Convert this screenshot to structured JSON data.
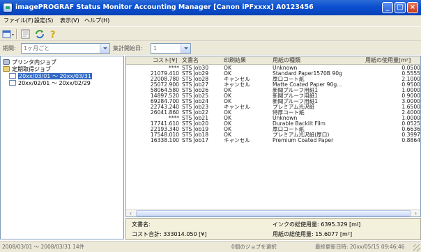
{
  "window": {
    "title": "imagePROGRAF Status Monitor Accounting Manager [Canon iPFxxxx] A0123456"
  },
  "menu": [
    "ファイル(F)",
    "設定(S)",
    "表示(V)",
    "ヘルプ(H)"
  ],
  "toolbar": {
    "icons": [
      "window-list-icon",
      "properties-icon",
      "refresh-icon",
      "help-icon"
    ]
  },
  "filter": {
    "period_label": "期間:",
    "period_value": "1ヶ月ごと",
    "start_label": "集計開始日:",
    "start_value": "1"
  },
  "tree": {
    "printer_jobs": "プリンタ内ジョブ",
    "saved_jobs": "定期取得ジョブ",
    "periods": [
      "20xx/03/01 〜 20xx/03/31",
      "20xx/02/01 〜 20xx/02/29"
    ],
    "selected_index": 0
  },
  "table": {
    "columns": [
      "コスト[¥]",
      "文書名",
      "印刷結果",
      "用紙の種類",
      "用紙の使用量[m²]"
    ],
    "rows": [
      {
        "cost": "****",
        "doc": "STS Job30",
        "result": "OK",
        "paper": "Unknown",
        "usage": "0.0500"
      },
      {
        "cost": "21079.410",
        "doc": "STS Job29",
        "result": "OK",
        "paper": "Standard Paper1570B 90g",
        "usage": "0.5555"
      },
      {
        "cost": "22008.780",
        "doc": "STS Job28",
        "result": "キャンセル",
        "paper": "厚口コート紙",
        "usage": "2.1000"
      },
      {
        "cost": "25072.900",
        "doc": "STS Job27",
        "result": "キャンセル",
        "paper": "Matte Coated Paper 90g...",
        "usage": "0.9500"
      },
      {
        "cost": "58064.580",
        "doc": "STS Job26",
        "result": "OK",
        "paper": "新聞プルーフ用紙1",
        "usage": "1.0000"
      },
      {
        "cost": "14897.520",
        "doc": "STS Job25",
        "result": "OK",
        "paper": "新聞プルーフ用紙1",
        "usage": "0.9000"
      },
      {
        "cost": "69284.700",
        "doc": "STS Job24",
        "result": "OK",
        "paper": "新聞プルーフ用紙1",
        "usage": "3.0000"
      },
      {
        "cost": "22743.240",
        "doc": "STS Job23",
        "result": "キャンセル",
        "paper": "プレミアム光沢紙",
        "usage": "1.6500"
      },
      {
        "cost": "26041.860",
        "doc": "STS Job22",
        "result": "OK",
        "paper": "特厚コート紙",
        "usage": "2.4000"
      },
      {
        "cost": "****",
        "doc": "STS Job21",
        "result": "OK",
        "paper": "Unknown",
        "usage": "1.0000"
      },
      {
        "cost": "17741.610",
        "doc": "STS Job20",
        "result": "OK",
        "paper": "Durable Backlit Film",
        "usage": "0.0525"
      },
      {
        "cost": "22193.340",
        "doc": "STS Job19",
        "result": "OK",
        "paper": "厚口コート紙",
        "usage": "0.6636"
      },
      {
        "cost": "17548.010",
        "doc": "STS Job18",
        "result": "OK",
        "paper": "プレミアム光沢紙(厚口)",
        "usage": "0.3997"
      },
      {
        "cost": "16338.100",
        "doc": "STS Job17",
        "result": "キャンセル",
        "paper": "Premium Coated Paper",
        "usage": "0.8864"
      }
    ]
  },
  "summary": {
    "doc_name_label": "文書名:",
    "cost_total": "コスト合計: 333014.050 [¥]",
    "ink_total": "インクの総使用量: 6395.329 [ml]",
    "paper_total": "用紙の総使用量: 15.6077 [m²]"
  },
  "status": {
    "period": "2008/03/01 〜 2008/03/31  14件",
    "selection": "0個のジョブを選択",
    "updated": "最終更新日時: 20xx/05/15 09:46:46"
  }
}
